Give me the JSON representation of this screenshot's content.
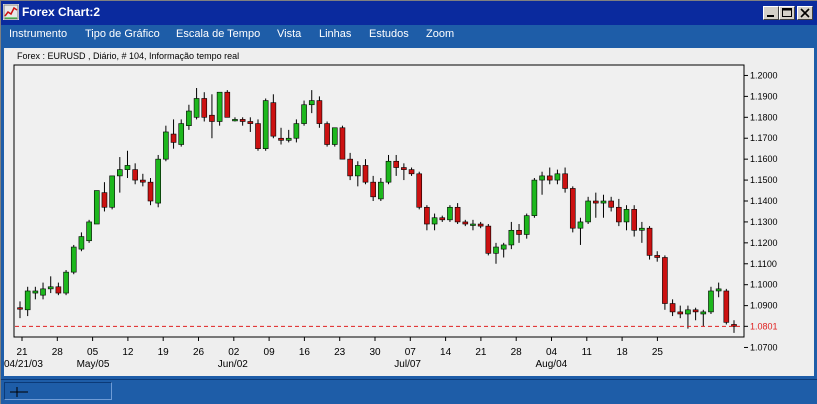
{
  "window": {
    "title": "Forex Chart:2",
    "icon": "chart-app-icon",
    "controls": [
      "minimize-icon",
      "maximize-icon",
      "close-icon"
    ]
  },
  "menu": {
    "items": [
      "Instrumento",
      "Tipo de Gráfico",
      "Escala de Tempo",
      "Vista",
      "Linhas",
      "Estudos",
      "Zoom"
    ]
  },
  "chart_header": {
    "caption": "Forex : EURUSD , Diário, # 104, Informação tempo real"
  },
  "colors": {
    "up_candle": "#1db71d",
    "down_candle": "#cc1111",
    "current_price_line": "#e02020",
    "frame_blue": "#1e5da8"
  },
  "chart_data": {
    "type": "candlestick",
    "symbol": "EURUSD",
    "timeframe": "Diário",
    "ylim": [
      1.075,
      1.205
    ],
    "yticks": [
      "1.2000",
      "1.1900",
      "1.1800",
      "1.1700",
      "1.1600",
      "1.1500",
      "1.1400",
      "1.1300",
      "1.1200",
      "1.1100",
      "1.1000",
      "1.0900",
      "1.0801",
      "1.0700"
    ],
    "current_price": "1.0801",
    "xtick_days": [
      "21",
      "28",
      "05",
      "12",
      "19",
      "26",
      "02",
      "09",
      "16",
      "23",
      "30",
      "07",
      "14",
      "21",
      "28",
      "04",
      "11",
      "18",
      "25"
    ],
    "xtick_months": [
      "04/21/03",
      "May/05",
      "Jun/02",
      "Jul/07",
      "Aug/04"
    ],
    "candles": [
      {
        "o": 1.089,
        "h": 1.092,
        "l": 1.084,
        "c": 1.0885
      },
      {
        "o": 1.088,
        "h": 1.099,
        "l": 1.085,
        "c": 1.097
      },
      {
        "o": 1.096,
        "h": 1.099,
        "l": 1.093,
        "c": 1.097
      },
      {
        "o": 1.095,
        "h": 1.101,
        "l": 1.093,
        "c": 1.098
      },
      {
        "o": 1.098,
        "h": 1.104,
        "l": 1.096,
        "c": 1.099
      },
      {
        "o": 1.099,
        "h": 1.101,
        "l": 1.095,
        "c": 1.096
      },
      {
        "o": 1.096,
        "h": 1.107,
        "l": 1.095,
        "c": 1.106
      },
      {
        "o": 1.106,
        "h": 1.119,
        "l": 1.105,
        "c": 1.118
      },
      {
        "o": 1.117,
        "h": 1.125,
        "l": 1.116,
        "c": 1.123
      },
      {
        "o": 1.121,
        "h": 1.131,
        "l": 1.12,
        "c": 1.13
      },
      {
        "o": 1.129,
        "h": 1.145,
        "l": 1.129,
        "c": 1.145
      },
      {
        "o": 1.144,
        "h": 1.149,
        "l": 1.135,
        "c": 1.137
      },
      {
        "o": 1.137,
        "h": 1.152,
        "l": 1.136,
        "c": 1.152
      },
      {
        "o": 1.152,
        "h": 1.161,
        "l": 1.144,
        "c": 1.155
      },
      {
        "o": 1.155,
        "h": 1.164,
        "l": 1.151,
        "c": 1.157
      },
      {
        "o": 1.155,
        "h": 1.158,
        "l": 1.148,
        "c": 1.15
      },
      {
        "o": 1.15,
        "h": 1.153,
        "l": 1.147,
        "c": 1.149
      },
      {
        "o": 1.149,
        "h": 1.151,
        "l": 1.138,
        "c": 1.14
      },
      {
        "o": 1.139,
        "h": 1.162,
        "l": 1.137,
        "c": 1.16
      },
      {
        "o": 1.16,
        "h": 1.176,
        "l": 1.159,
        "c": 1.173
      },
      {
        "o": 1.172,
        "h": 1.179,
        "l": 1.165,
        "c": 1.168
      },
      {
        "o": 1.167,
        "h": 1.179,
        "l": 1.166,
        "c": 1.177
      },
      {
        "o": 1.176,
        "h": 1.186,
        "l": 1.174,
        "c": 1.183
      },
      {
        "o": 1.18,
        "h": 1.194,
        "l": 1.179,
        "c": 1.189
      },
      {
        "o": 1.189,
        "h": 1.192,
        "l": 1.178,
        "c": 1.18
      },
      {
        "o": 1.181,
        "h": 1.191,
        "l": 1.17,
        "c": 1.178
      },
      {
        "o": 1.178,
        "h": 1.192,
        "l": 1.176,
        "c": 1.192
      },
      {
        "o": 1.192,
        "h": 1.193,
        "l": 1.18,
        "c": 1.18
      },
      {
        "o": 1.179,
        "h": 1.18,
        "l": 1.178,
        "c": 1.179
      },
      {
        "o": 1.179,
        "h": 1.18,
        "l": 1.176,
        "c": 1.178
      },
      {
        "o": 1.178,
        "h": 1.18,
        "l": 1.173,
        "c": 1.177
      },
      {
        "o": 1.177,
        "h": 1.179,
        "l": 1.164,
        "c": 1.165
      },
      {
        "o": 1.165,
        "h": 1.189,
        "l": 1.164,
        "c": 1.188
      },
      {
        "o": 1.187,
        "h": 1.191,
        "l": 1.17,
        "c": 1.171
      },
      {
        "o": 1.17,
        "h": 1.175,
        "l": 1.167,
        "c": 1.169
      },
      {
        "o": 1.169,
        "h": 1.174,
        "l": 1.168,
        "c": 1.17
      },
      {
        "o": 1.17,
        "h": 1.179,
        "l": 1.168,
        "c": 1.177
      },
      {
        "o": 1.177,
        "h": 1.188,
        "l": 1.176,
        "c": 1.186
      },
      {
        "o": 1.186,
        "h": 1.193,
        "l": 1.182,
        "c": 1.188
      },
      {
        "o": 1.188,
        "h": 1.19,
        "l": 1.175,
        "c": 1.177
      },
      {
        "o": 1.177,
        "h": 1.178,
        "l": 1.166,
        "c": 1.167
      },
      {
        "o": 1.167,
        "h": 1.175,
        "l": 1.166,
        "c": 1.175
      },
      {
        "o": 1.175,
        "h": 1.176,
        "l": 1.16,
        "c": 1.16
      },
      {
        "o": 1.16,
        "h": 1.163,
        "l": 1.15,
        "c": 1.152
      },
      {
        "o": 1.152,
        "h": 1.159,
        "l": 1.147,
        "c": 1.157
      },
      {
        "o": 1.157,
        "h": 1.16,
        "l": 1.148,
        "c": 1.149
      },
      {
        "o": 1.149,
        "h": 1.152,
        "l": 1.14,
        "c": 1.142
      },
      {
        "o": 1.141,
        "h": 1.151,
        "l": 1.14,
        "c": 1.149
      },
      {
        "o": 1.149,
        "h": 1.162,
        "l": 1.148,
        "c": 1.159
      },
      {
        "o": 1.159,
        "h": 1.162,
        "l": 1.152,
        "c": 1.156
      },
      {
        "o": 1.156,
        "h": 1.158,
        "l": 1.15,
        "c": 1.155
      },
      {
        "o": 1.155,
        "h": 1.156,
        "l": 1.152,
        "c": 1.153
      },
      {
        "o": 1.153,
        "h": 1.154,
        "l": 1.136,
        "c": 1.137
      },
      {
        "o": 1.137,
        "h": 1.138,
        "l": 1.126,
        "c": 1.129
      },
      {
        "o": 1.129,
        "h": 1.134,
        "l": 1.126,
        "c": 1.132
      },
      {
        "o": 1.132,
        "h": 1.133,
        "l": 1.13,
        "c": 1.131
      },
      {
        "o": 1.131,
        "h": 1.138,
        "l": 1.13,
        "c": 1.137
      },
      {
        "o": 1.137,
        "h": 1.139,
        "l": 1.129,
        "c": 1.13
      },
      {
        "o": 1.13,
        "h": 1.131,
        "l": 1.128,
        "c": 1.129
      },
      {
        "o": 1.129,
        "h": 1.131,
        "l": 1.126,
        "c": 1.129
      },
      {
        "o": 1.129,
        "h": 1.13,
        "l": 1.127,
        "c": 1.128
      },
      {
        "o": 1.128,
        "h": 1.129,
        "l": 1.114,
        "c": 1.115
      },
      {
        "o": 1.115,
        "h": 1.12,
        "l": 1.11,
        "c": 1.118
      },
      {
        "o": 1.117,
        "h": 1.12,
        "l": 1.113,
        "c": 1.119
      },
      {
        "o": 1.119,
        "h": 1.13,
        "l": 1.117,
        "c": 1.126
      },
      {
        "o": 1.126,
        "h": 1.129,
        "l": 1.12,
        "c": 1.124
      },
      {
        "o": 1.124,
        "h": 1.134,
        "l": 1.122,
        "c": 1.133
      },
      {
        "o": 1.133,
        "h": 1.151,
        "l": 1.132,
        "c": 1.15
      },
      {
        "o": 1.15,
        "h": 1.154,
        "l": 1.143,
        "c": 1.152
      },
      {
        "o": 1.152,
        "h": 1.156,
        "l": 1.148,
        "c": 1.15
      },
      {
        "o": 1.15,
        "h": 1.155,
        "l": 1.148,
        "c": 1.153
      },
      {
        "o": 1.153,
        "h": 1.156,
        "l": 1.144,
        "c": 1.146
      },
      {
        "o": 1.146,
        "h": 1.147,
        "l": 1.125,
        "c": 1.127
      },
      {
        "o": 1.127,
        "h": 1.132,
        "l": 1.119,
        "c": 1.13
      },
      {
        "o": 1.13,
        "h": 1.142,
        "l": 1.129,
        "c": 1.14
      },
      {
        "o": 1.14,
        "h": 1.144,
        "l": 1.132,
        "c": 1.139
      },
      {
        "o": 1.139,
        "h": 1.143,
        "l": 1.132,
        "c": 1.14
      },
      {
        "o": 1.14,
        "h": 1.142,
        "l": 1.135,
        "c": 1.137
      },
      {
        "o": 1.137,
        "h": 1.141,
        "l": 1.128,
        "c": 1.13
      },
      {
        "o": 1.13,
        "h": 1.138,
        "l": 1.126,
        "c": 1.136
      },
      {
        "o": 1.136,
        "h": 1.138,
        "l": 1.123,
        "c": 1.126
      },
      {
        "o": 1.126,
        "h": 1.13,
        "l": 1.12,
        "c": 1.127
      },
      {
        "o": 1.127,
        "h": 1.128,
        "l": 1.112,
        "c": 1.114
      },
      {
        "o": 1.114,
        "h": 1.116,
        "l": 1.111,
        "c": 1.113
      },
      {
        "o": 1.113,
        "h": 1.114,
        "l": 1.088,
        "c": 1.091
      },
      {
        "o": 1.091,
        "h": 1.093,
        "l": 1.085,
        "c": 1.087
      },
      {
        "o": 1.087,
        "h": 1.09,
        "l": 1.084,
        "c": 1.086
      },
      {
        "o": 1.086,
        "h": 1.09,
        "l": 1.079,
        "c": 1.088
      },
      {
        "o": 1.088,
        "h": 1.089,
        "l": 1.083,
        "c": 1.087
      },
      {
        "o": 1.086,
        "h": 1.088,
        "l": 1.08,
        "c": 1.087
      },
      {
        "o": 1.087,
        "h": 1.099,
        "l": 1.086,
        "c": 1.097
      },
      {
        "o": 1.097,
        "h": 1.101,
        "l": 1.094,
        "c": 1.098
      },
      {
        "o": 1.097,
        "h": 1.098,
        "l": 1.081,
        "c": 1.082
      },
      {
        "o": 1.081,
        "h": 1.083,
        "l": 1.077,
        "c": 1.0801
      }
    ]
  },
  "status": {
    "cursor_tool_icon": "crosshair-icon"
  }
}
